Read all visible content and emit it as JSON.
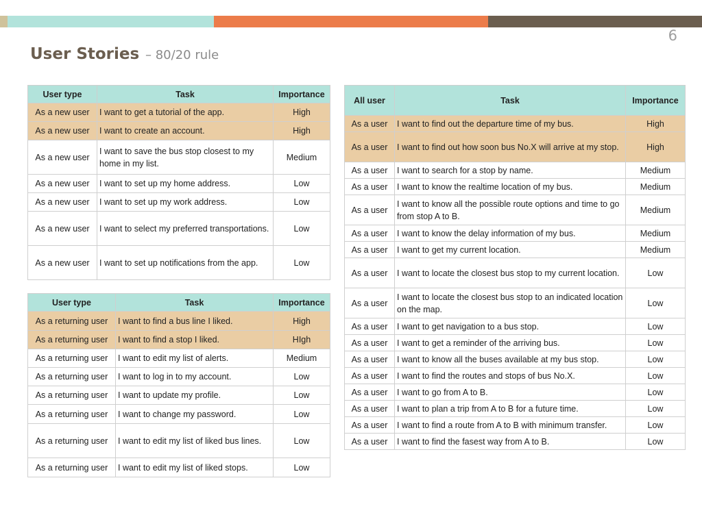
{
  "page_number": "6",
  "title": "User Stories",
  "subtitle": "– 80/20 rule",
  "colors": {
    "bar": [
      "#cfc29b",
      "#b2e3db",
      "#ec7c4a",
      "#6b5e4f"
    ],
    "header_fill": "#b2e3db",
    "priority_fill": "#eacda4",
    "title": "#6b5e4f"
  },
  "tables": {
    "new_user": {
      "headers": [
        "User type",
        "Task",
        "Importance"
      ],
      "rows": [
        {
          "type": "As a new user",
          "task": "I want to get a tutorial of the app.",
          "importance": "High",
          "highlight": true
        },
        {
          "type": "As a new user",
          "task": "I want to create an account.",
          "importance": "High",
          "highlight": true
        },
        {
          "type": "As a new user",
          "task": "I want to save the bus stop closest to my home in my list.",
          "importance": "Medium",
          "highlight": false
        },
        {
          "type": "As a new user",
          "task": "I want to set up my home address.",
          "importance": "Low",
          "highlight": false
        },
        {
          "type": "As a new user",
          "task": "I want to set up my work address.",
          "importance": "Low",
          "highlight": false
        },
        {
          "type": "As a new user",
          "task": "I want to select my preferred transportations.",
          "importance": "Low",
          "highlight": false
        },
        {
          "type": "As a new user",
          "task": "I want to set up notifications from the app.",
          "importance": "Low",
          "highlight": false
        }
      ]
    },
    "returning_user": {
      "headers": [
        "User type",
        "Task",
        "Importance"
      ],
      "rows": [
        {
          "type": "As a returning user",
          "task": "I want to find a bus line I liked.",
          "importance": "High",
          "highlight": true
        },
        {
          "type": "As a returning user",
          "task": "I want to find a stop I liked.",
          "importance": "HIgh",
          "highlight": true
        },
        {
          "type": "As a returning user",
          "task": "I want to edit my list of alerts.",
          "importance": "Medium",
          "highlight": false
        },
        {
          "type": "As a returning user",
          "task": "I want to log in to my account.",
          "importance": "Low",
          "highlight": false
        },
        {
          "type": "As a returning user",
          "task": "I want to update my profile.",
          "importance": "Low",
          "highlight": false
        },
        {
          "type": "As a returning user",
          "task": "I want to change my password.",
          "importance": "Low",
          "highlight": false
        },
        {
          "type": "As a returning user",
          "task": "I want to edit my list of liked bus lines.",
          "importance": "Low",
          "highlight": false
        },
        {
          "type": "As a returning user",
          "task": "I want to edit my list of liked stops.",
          "importance": "Low",
          "highlight": false
        }
      ]
    },
    "all_user": {
      "headers": [
        "All user",
        "Task",
        "Importance"
      ],
      "rows": [
        {
          "type": "As a user",
          "task": "I want to find out the departure time of my bus.",
          "importance": "High",
          "highlight": true
        },
        {
          "type": "As a user",
          "task": "I want to find out how soon bus No.X will arrive at my stop.",
          "importance": "High",
          "highlight": true
        },
        {
          "type": "As a user",
          "task": "I want to search for a stop by name.",
          "importance": "Medium",
          "highlight": false
        },
        {
          "type": "As a user",
          "task": "I want to know the realtime location of my bus.",
          "importance": "Medium",
          "highlight": false
        },
        {
          "type": "As a user",
          "task": "I want to know all the possible route options and time to go from stop A to B.",
          "importance": "Medium",
          "highlight": false
        },
        {
          "type": "As a user",
          "task": "I want to know the delay information of my bus.",
          "importance": "Medium",
          "highlight": false
        },
        {
          "type": "As a user",
          "task": "I want to get my current location.",
          "importance": "Medium",
          "highlight": false
        },
        {
          "type": "As a user",
          "task": "I want to locate the closest bus stop to my current location.",
          "importance": "Low",
          "highlight": false
        },
        {
          "type": "As a user",
          "task": "I want to locate the closest bus stop to an indicated location on the map.",
          "importance": "Low",
          "highlight": false
        },
        {
          "type": "As a user",
          "task": "I want to get navigation to a bus stop.",
          "importance": "Low",
          "highlight": false
        },
        {
          "type": "As a user",
          "task": "I want to get a reminder of the arriving bus.",
          "importance": "Low",
          "highlight": false
        },
        {
          "type": "As a user",
          "task": "I want to know all the buses available at my bus stop.",
          "importance": "Low",
          "highlight": false
        },
        {
          "type": "As a user",
          "task": "I want to find the routes and stops of bus No.X.",
          "importance": "Low",
          "highlight": false
        },
        {
          "type": "As a user",
          "task": "I want to go from A to B.",
          "importance": "Low",
          "highlight": false
        },
        {
          "type": "As a user",
          "task": "I want to plan a trip from A to B for a future time.",
          "importance": "Low",
          "highlight": false
        },
        {
          "type": "As a user",
          "task": "I want to find a route from A to B with minimum transfer.",
          "importance": "Low",
          "highlight": false
        },
        {
          "type": "As a user",
          "task": "I want to find the fasest way from A to B.",
          "importance": "Low",
          "highlight": false
        }
      ]
    }
  }
}
